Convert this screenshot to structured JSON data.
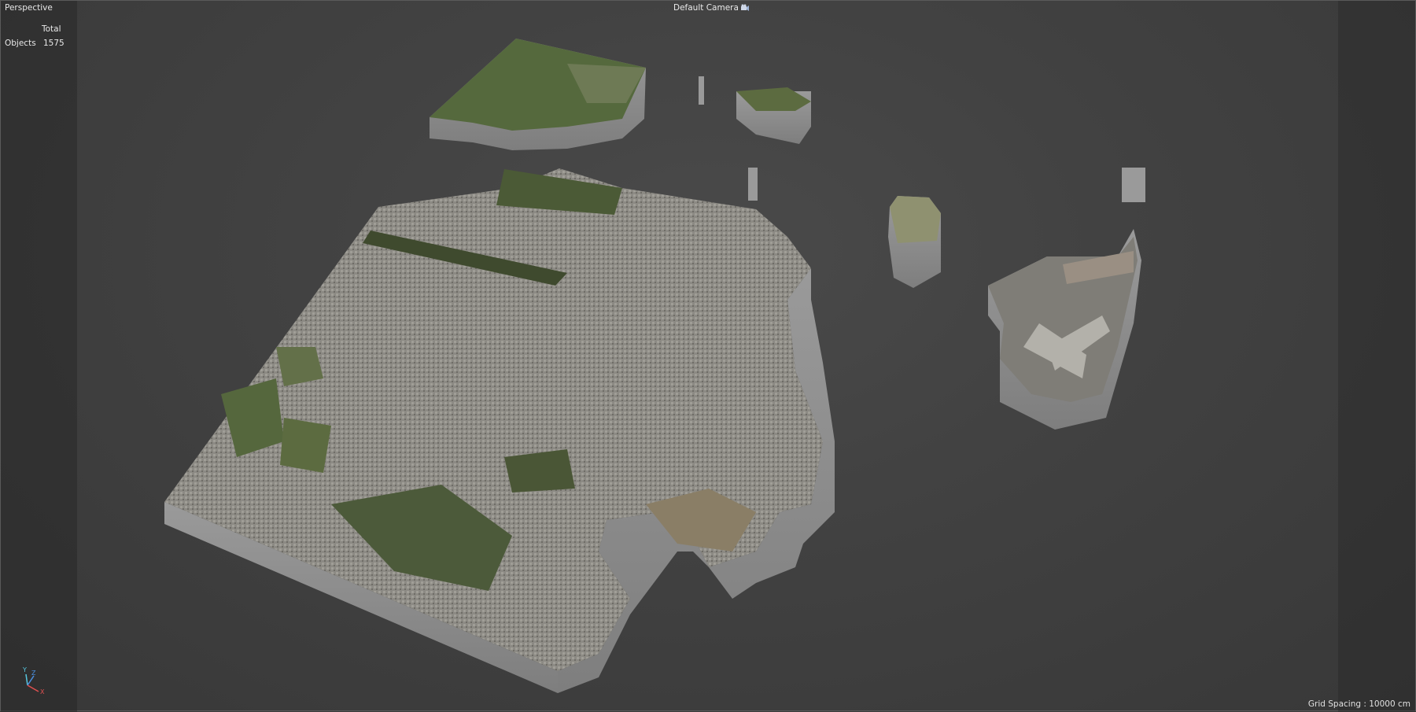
{
  "viewport": {
    "projection_label": "Perspective",
    "camera_label": "Default Camera",
    "grid_info": "Grid Spacing : 10000 cm"
  },
  "stats": {
    "total_header": "Total",
    "objects_label": "Objects",
    "objects_count": "1575"
  },
  "axis": {
    "y_label": "Y",
    "z_label": "Z",
    "x_label": "X"
  },
  "colors": {
    "background": "#3a3a3a",
    "extrusion_side": "#8a8a8a",
    "axis_y": "#57c8e0",
    "axis_z": "#4a8fe0",
    "axis_x": "#e05050"
  },
  "icons": {
    "camera": "camera-icon",
    "axis": "xyz-axis-gizmo-icon"
  }
}
